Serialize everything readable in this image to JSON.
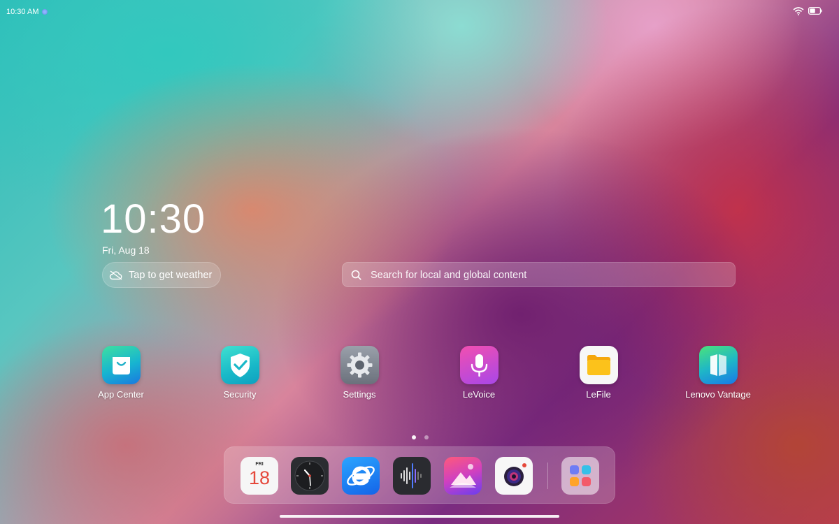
{
  "status_bar": {
    "time": "10:30 AM"
  },
  "clock_widget": {
    "time": "10:30",
    "date": "Fri, Aug 18"
  },
  "weather": {
    "label": "Tap to get weather"
  },
  "search": {
    "placeholder": "Search for local and global content"
  },
  "apps": [
    {
      "label": "App Center",
      "icon": "shopping-bag-icon"
    },
    {
      "label": "Security",
      "icon": "shield-check-icon"
    },
    {
      "label": "Settings",
      "icon": "gear-icon"
    },
    {
      "label": "LeVoice",
      "icon": "microphone-icon"
    },
    {
      "label": "LeFile",
      "icon": "folder-icon"
    },
    {
      "label": "Lenovo Vantage",
      "icon": "vantage-icon"
    }
  ],
  "page_indicator": {
    "current": 1,
    "total": 2
  },
  "dock": {
    "calendar_day": "FRI",
    "calendar_date": "18",
    "items": [
      "calendar-icon",
      "clock-icon",
      "browser-icon",
      "voice-recorder-icon",
      "gallery-icon",
      "camera-icon",
      "app-drawer-icon"
    ]
  },
  "colors": {
    "accent": "#1677ff",
    "calendar_red": "#e5483b"
  }
}
